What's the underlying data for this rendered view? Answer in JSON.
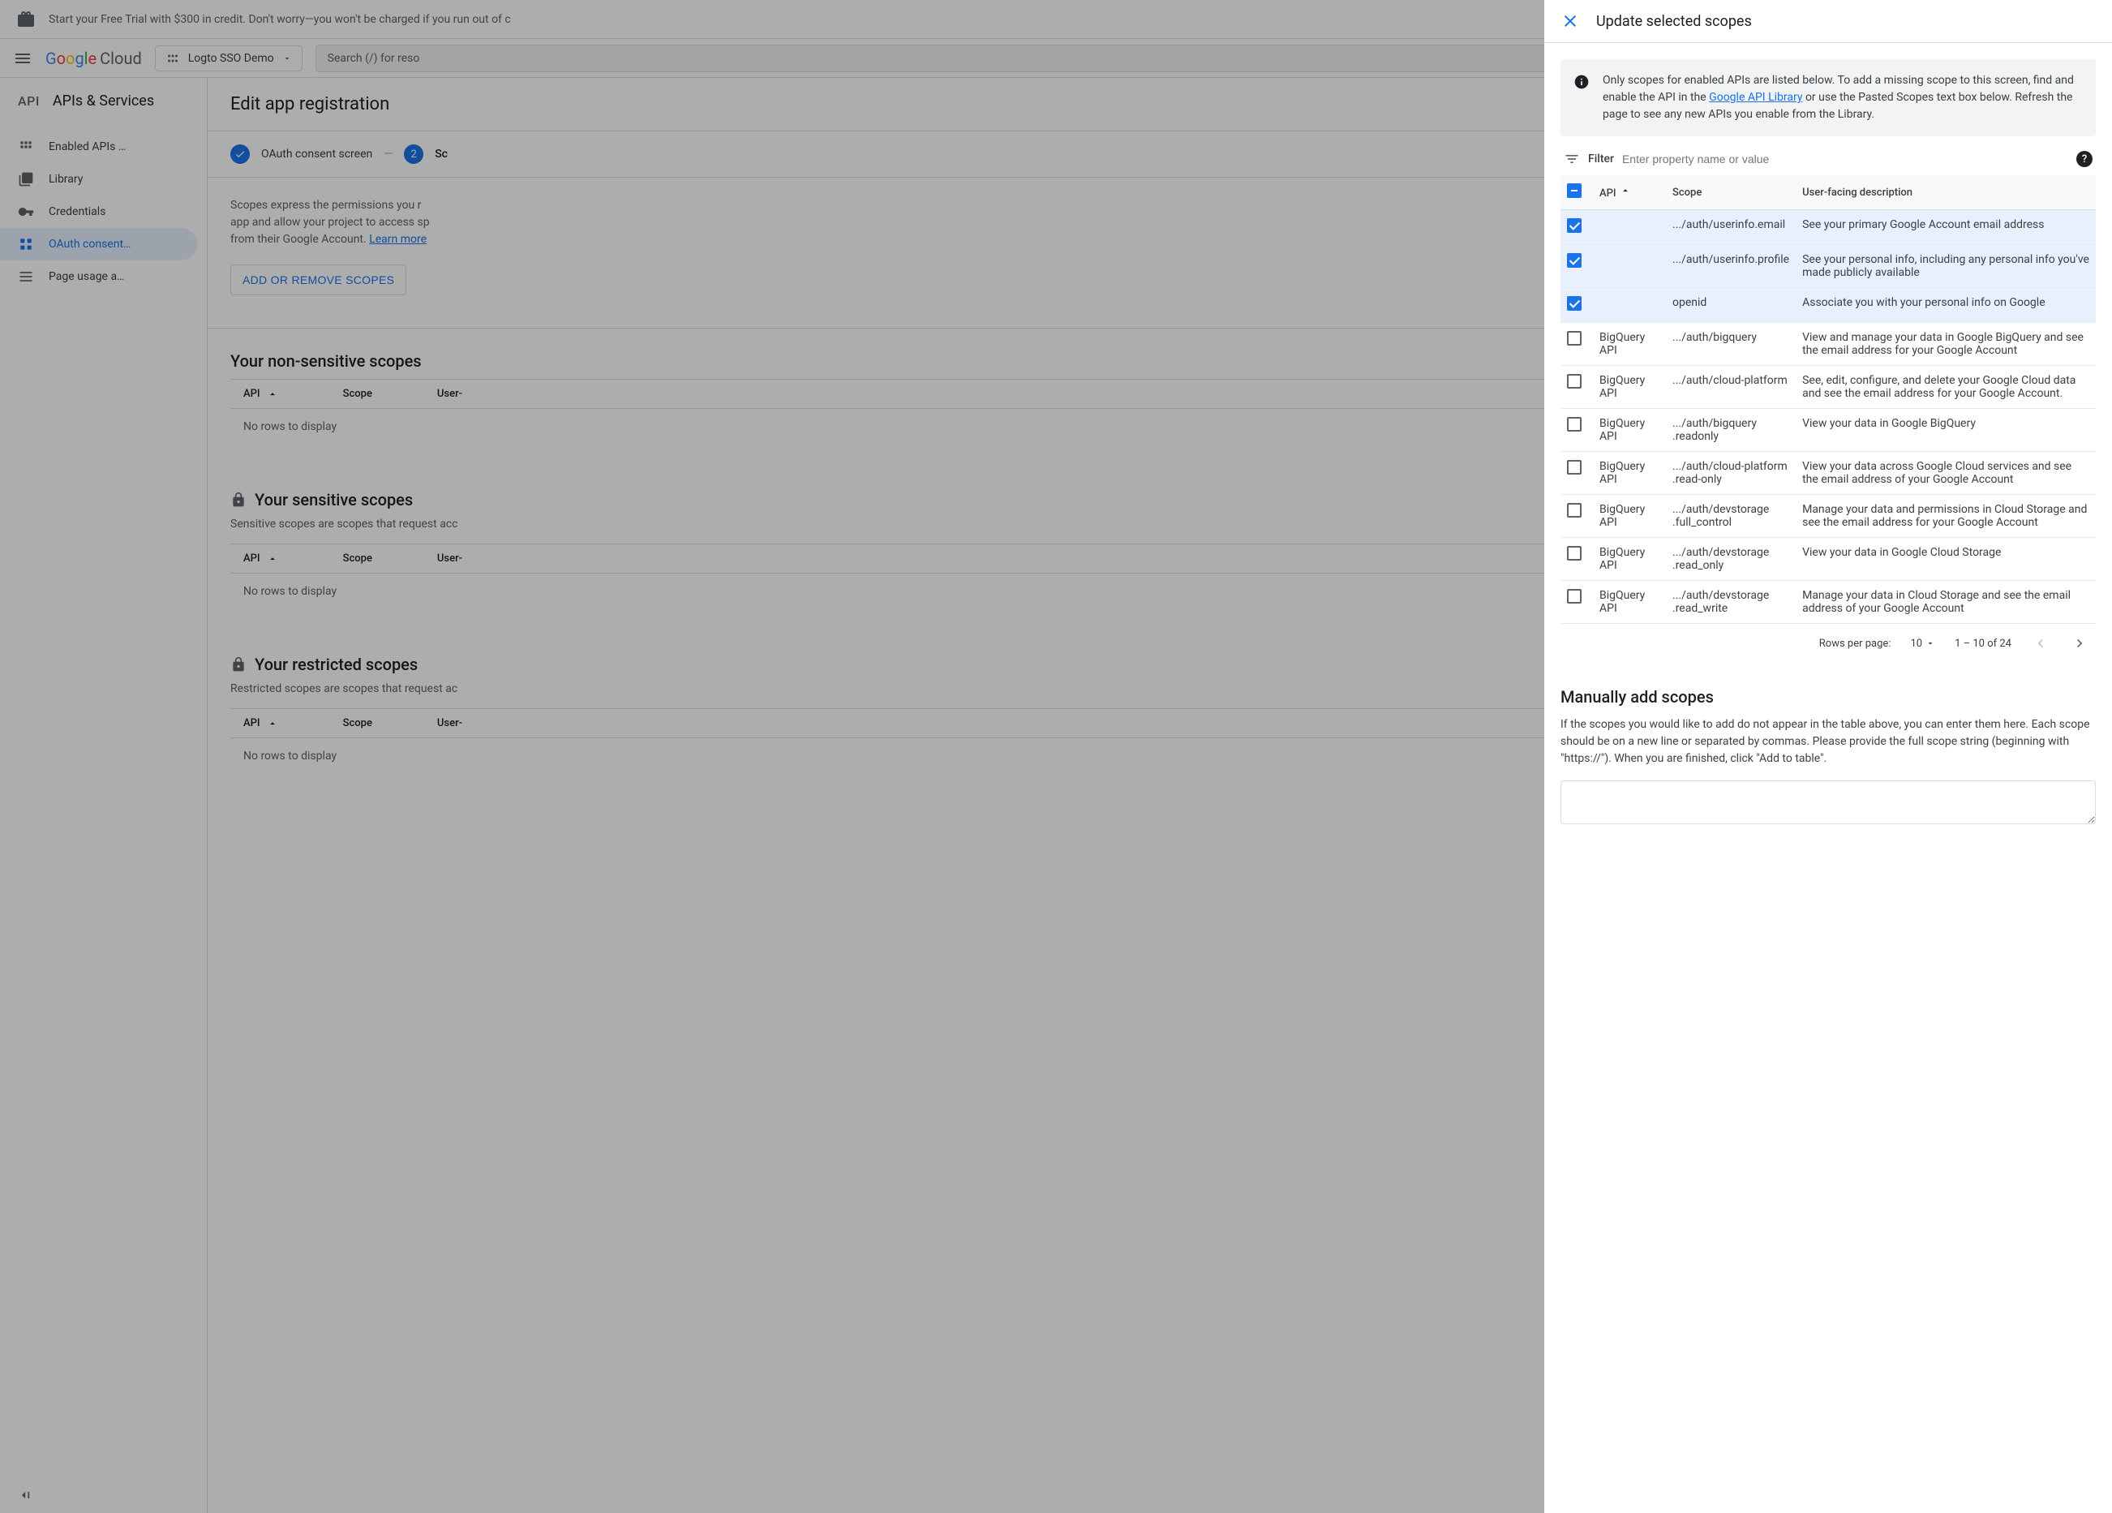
{
  "banner": {
    "text": "Start your Free Trial with $300 in credit. Don't worry—you won't be charged if you run out of c"
  },
  "header": {
    "project": "Logto SSO Demo",
    "search_placeholder": "Search (/) for reso"
  },
  "sidebar": {
    "title": "APIs & Services",
    "items": [
      {
        "label": "Enabled APIs …",
        "icon": "grid"
      },
      {
        "label": "Library",
        "icon": "library"
      },
      {
        "label": "Credentials",
        "icon": "key"
      },
      {
        "label": "OAuth consent…",
        "icon": "consent",
        "active": true
      },
      {
        "label": "Page usage a…",
        "icon": "usage"
      }
    ]
  },
  "content": {
    "title": "Edit app registration",
    "step1": "OAuth consent screen",
    "step2_num": "2",
    "step2_label": "Sc",
    "scopes_intro": "Scopes express the permissions you r\napp and allow your project to access sp\nfrom their Google Account. ",
    "learn_more": "Learn more",
    "add_remove_btn": "ADD OR REMOVE SCOPES",
    "nonsensitive_title": "Your non-sensitive scopes",
    "sensitive_title": "Your sensitive scopes",
    "sensitive_desc": "Sensitive scopes are scopes that request acc",
    "restricted_title": "Your restricted scopes",
    "restricted_desc": "Restricted scopes are scopes that request ac",
    "th_api": "API",
    "th_scope": "Scope",
    "th_desc": "User-",
    "no_rows": "No rows to display"
  },
  "panel": {
    "title": "Update selected scopes",
    "info_text_1": "Only scopes for enabled APIs are listed below. To add a missing scope to this screen, find and enable the API in the ",
    "info_link": "Google API Library",
    "info_text_2": " or use the Pasted Scopes text box below. Refresh the page to see any new APIs you enable from the Library.",
    "filter_label": "Filter",
    "filter_placeholder": "Enter property name or value",
    "th_api": "API",
    "th_scope": "Scope",
    "th_desc": "User-facing description",
    "rows": [
      {
        "checked": true,
        "api": "",
        "scope": ".../auth/userinfo.email",
        "desc": "See your primary Google Account email address"
      },
      {
        "checked": true,
        "api": "",
        "scope": ".../auth/userinfo.profile",
        "desc": "See your personal info, including any personal info you've made publicly available"
      },
      {
        "checked": true,
        "api": "",
        "scope": "openid",
        "desc": "Associate you with your personal info on Google"
      },
      {
        "checked": false,
        "api": "BigQuery API",
        "scope": ".../auth/bigquery",
        "desc": "View and manage your data in Google BigQuery and see the email address for your Google Account"
      },
      {
        "checked": false,
        "api": "BigQuery API",
        "scope": ".../auth/cloud-platform",
        "desc": "See, edit, configure, and delete your Google Cloud data and see the email address for your Google Account."
      },
      {
        "checked": false,
        "api": "BigQuery API",
        "scope": ".../auth/bigquery .readonly",
        "desc": "View your data in Google BigQuery"
      },
      {
        "checked": false,
        "api": "BigQuery API",
        "scope": ".../auth/cloud-platform .read-only",
        "desc": "View your data across Google Cloud services and see the email address of your Google Account"
      },
      {
        "checked": false,
        "api": "BigQuery API",
        "scope": ".../auth/devstorage .full_control",
        "desc": "Manage your data and permissions in Cloud Storage and see the email address for your Google Account"
      },
      {
        "checked": false,
        "api": "BigQuery API",
        "scope": ".../auth/devstorage .read_only",
        "desc": "View your data in Google Cloud Storage"
      },
      {
        "checked": false,
        "api": "BigQuery API",
        "scope": ".../auth/devstorage .read_write",
        "desc": "Manage your data in Cloud Storage and see the email address of your Google Account"
      }
    ],
    "rows_per_page_label": "Rows per page:",
    "rows_per_page_value": "10",
    "page_range": "1 – 10 of 24",
    "manual_title": "Manually add scopes",
    "manual_text": "If the scopes you would like to add do not appear in the table above, you can enter them here. Each scope should be on a new line or separated by commas. Please provide the full scope string (beginning with \"https://\"). When you are finished, click \"Add to table\"."
  }
}
